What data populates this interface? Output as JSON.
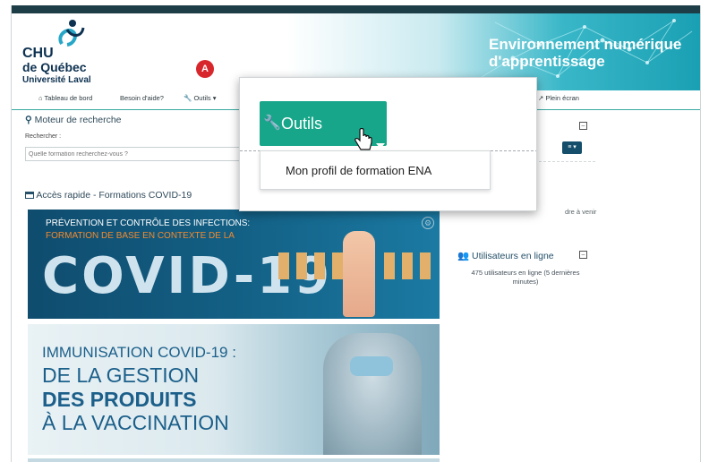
{
  "header": {
    "logo_line1": "CHU",
    "logo_line2": "de Québec",
    "logo_line3": "Université Laval",
    "badge": "A",
    "env_line1": "Environnement numérique",
    "env_line2": "d'apprentissage"
  },
  "nav": {
    "home": "Tableau de bord",
    "help": "Besoin d'aide?",
    "tools": "Outils",
    "fullscreen": "Plein écran"
  },
  "search": {
    "title": "Moteur de recherche",
    "label": "Rechercher :",
    "placeholder": "Quelle formation recherchez-vous ?"
  },
  "covid": {
    "title": "Accès rapide - Formations COVID-19",
    "banner1_line1": "PRÉVENTION ET CONTRÔLE DES INFECTIONS:",
    "banner1_line2": "FORMATION DE BASE EN CONTEXTE DE LA",
    "banner1_big": "COVID-19",
    "banner2_line1": "IMMUNISATION COVID-19 :",
    "banner2_line2": "DE LA GESTION",
    "banner2_line3": "DES PRODUITS",
    "banner2_line4": "À LA VACCINATION"
  },
  "right": {
    "snippet": "dre à venir",
    "online_title": "Utilisateurs en ligne",
    "online_text": "475 utilisateurs en ligne (5 dernières minutes)"
  },
  "zoom": {
    "tools_label": "Outils",
    "menu_item": "Mon profil de formation ENA"
  },
  "colors": {
    "accent_green": "#18a68a",
    "badge_red": "#d8262d",
    "navy": "#0d3150",
    "teal": "#1aa0b3"
  }
}
